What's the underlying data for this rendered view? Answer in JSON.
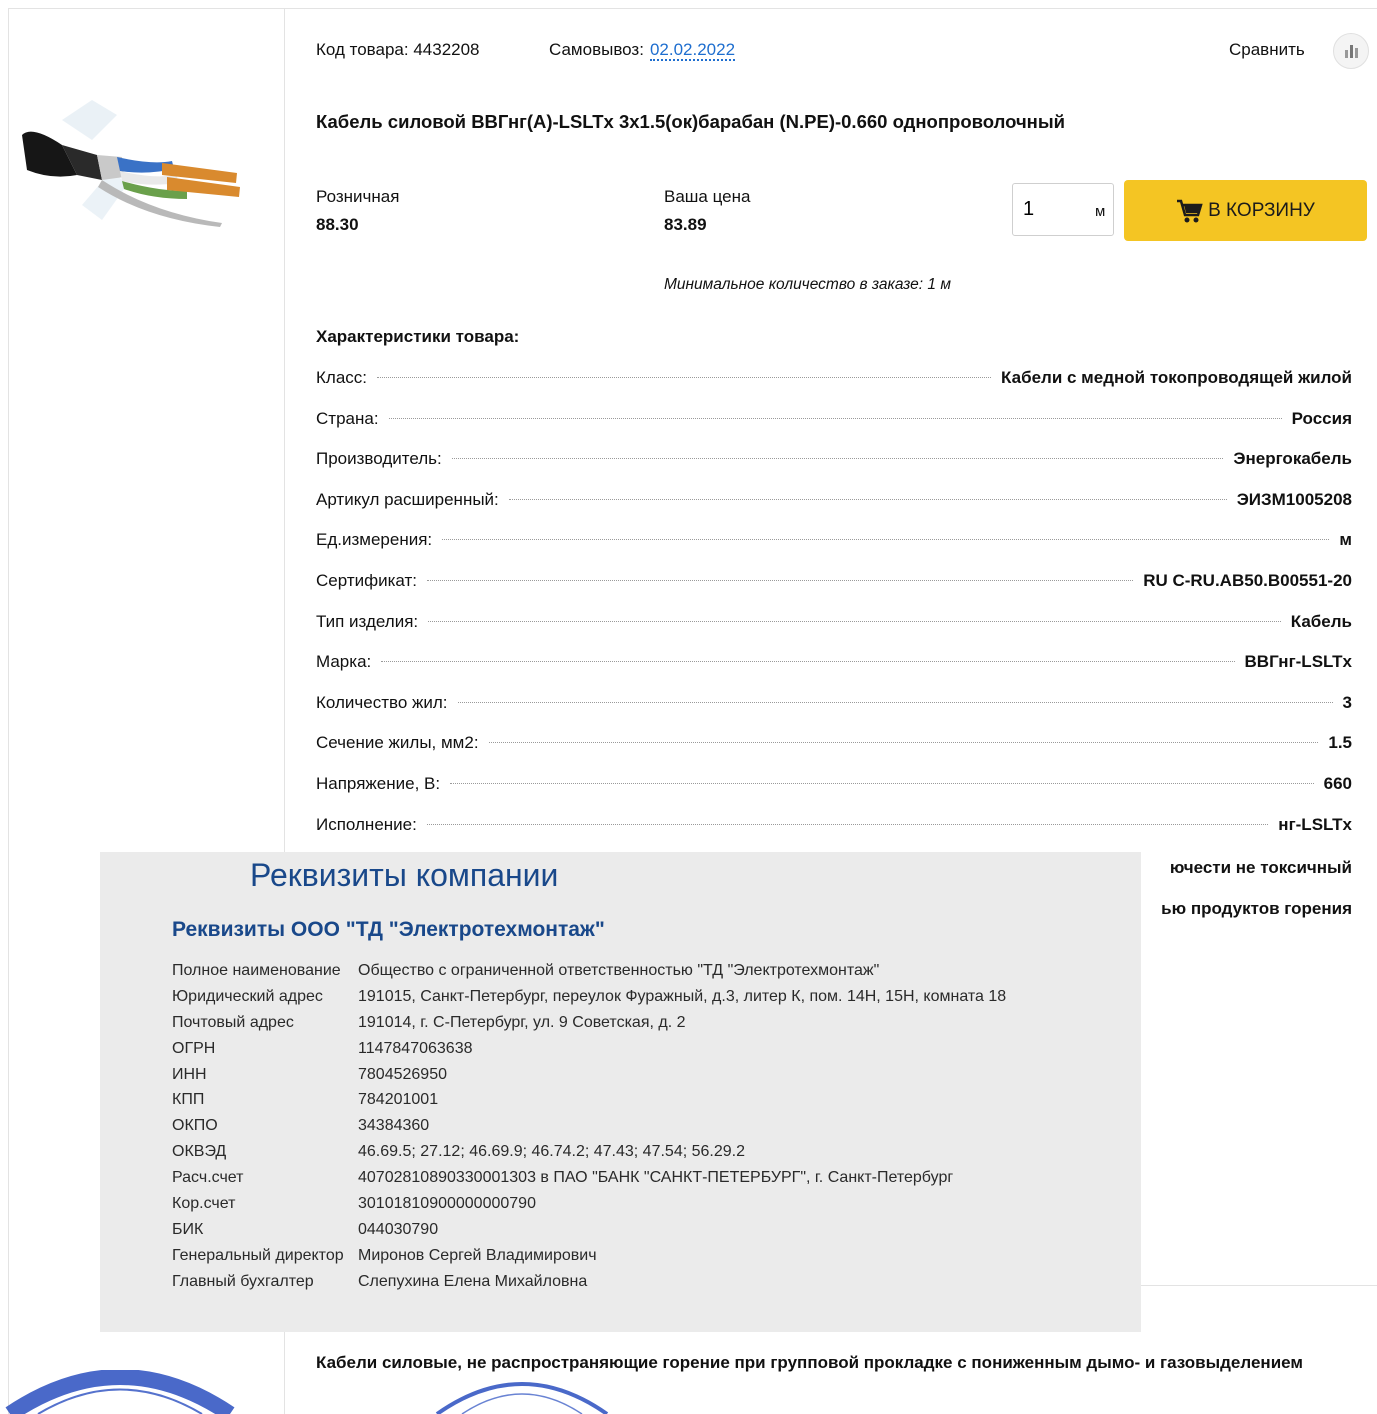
{
  "product": {
    "code_text": "Код товара: 4432208",
    "pickup_label": "Самовывоз:",
    "pickup_date": "02.02.2022",
    "compare_label": "Сравнить",
    "title": "Кабель силовой ВВГнг(А)-LSLTx 3x1.5(ок)барабан (N.PE)-0.660 однопроволочный"
  },
  "pricing": {
    "retail_label": "Розничная",
    "retail_value": "88.30",
    "your_label": "Ваша цена",
    "your_value": "83.89",
    "quantity": "1",
    "unit": "м",
    "cart_label": "В КОРЗИНУ",
    "min_order": "Минимальное количество в заказе: 1 м"
  },
  "specs": {
    "heading": "Характеристики товара:",
    "rows": [
      {
        "k": "Класс:",
        "v": "Кабели с медной токопроводящей жилой"
      },
      {
        "k": "Страна:",
        "v": "Россия"
      },
      {
        "k": "Производитель:",
        "v": "Энергокабель"
      },
      {
        "k": "Артикул расширенный:",
        "v": "ЭИЗМ1005208"
      },
      {
        "k": "Ед.измерения:",
        "v": "м"
      },
      {
        "k": "Сертификат:",
        "v": "RU C-RU.AB50.B00551-20"
      },
      {
        "k": "Тип изделия:",
        "v": "Кабель"
      },
      {
        "k": "Марка:",
        "v": "ВВГнг-LSLTx"
      },
      {
        "k": "Количество жил:",
        "v": "3"
      },
      {
        "k": "Сечение жилы, мм2:",
        "v": "1.5"
      },
      {
        "k": "Напряжение, В:",
        "v": "660"
      },
      {
        "k": "Исполнение:",
        "v": "нг-LSLTx"
      }
    ],
    "partial_1": "ючести не токсичный",
    "partial_2": "ью продуктов горения"
  },
  "requisites": {
    "title": "Реквизиты компании",
    "subtitle": "Реквизиты ООО \"ТД \"Электротехмонтаж\"",
    "rows": [
      {
        "k": "Полное наименование",
        "v": "Общество с ограниченной ответственностью \"ТД \"Электротехмонтаж\""
      },
      {
        "k": "Юридический адрес",
        "v": "191015, Санкт-Петербург, переулок Фуражный, д.3, литер К, пом. 14Н, 15Н, комната 18"
      },
      {
        "k": "Почтовый адрес",
        "v": "191014, г. С-Петербург, ул. 9 Советская, д. 2"
      },
      {
        "k": "ОГРН",
        "v": "1147847063638"
      },
      {
        "k": "ИНН",
        "v": "7804526950"
      },
      {
        "k": "КПП",
        "v": "784201001"
      },
      {
        "k": "ОКПО",
        "v": "34384360"
      },
      {
        "k": "ОКВЭД",
        "v": "46.69.5; 27.12; 46.69.9; 46.74.2; 47.43; 47.54; 56.29.2"
      },
      {
        "k": "Расч.счет",
        "v": "40702810890330001303 в ПАО \"БАНК \"САНКТ-ПЕТЕРБУРГ\", г. Санкт-Петербург"
      },
      {
        "k": "Кор.счет",
        "v": "30101810900000000790"
      },
      {
        "k": "БИК",
        "v": "044030790"
      },
      {
        "k": "Генеральный директор",
        "v": "Миронов Сергей Владимирович"
      },
      {
        "k": "Главный бухгалтер",
        "v": "Слепухина Елена Михайловна"
      }
    ]
  },
  "description": "Кабели силовые, не распространяющие горение при групповой прокладке с пониженным дымо- и газовыделением",
  "colors": {
    "accent_yellow": "#f4c523",
    "link_blue": "#1e6ecf",
    "requisites_blue": "#19488a"
  },
  "icons": [
    "shopping-cart-icon",
    "compare-chart-icon"
  ]
}
